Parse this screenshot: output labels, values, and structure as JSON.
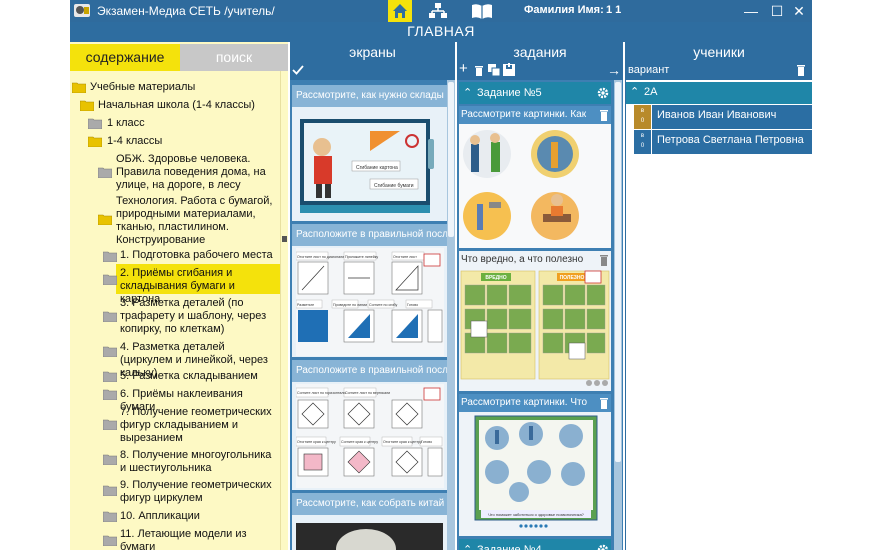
{
  "app": {
    "title": "Экзамен-Медиа СЕТЬ /учитель/",
    "user_label": "Фамилия Имя:",
    "user_name": "1 1",
    "main_header": "ГЛАВНАЯ"
  },
  "panel_tabs": {
    "content": "содержание",
    "search": "поиск"
  },
  "tree": [
    "Учебные материалы",
    "Начальная школа (1-4 классы)",
    "1 класс",
    "1-4 классы",
    "ОБЖ. Здоровье человека. Правила поведения дома, на улице, на дороге, в лесу",
    "Технология. Работа с бумагой, природными материалами, тканью, пластилином. Конструирование",
    "1. Подготовка рабочего места",
    "2. Приёмы сгибания и складывания бумаги и картона",
    "3. Разметка деталей (по трафарету и шаблону, через копирку, по клеткам)",
    "4. Разметка деталей (циркулем и линейкой, через кальку)",
    "5. Разметка складыванием",
    "6. Приёмы наклеивания бумаги",
    "7. Получение геометрических фигур складыванием и вырезанием",
    "8. Получение многоугольника и шестиугольника",
    "9. Получение геометрических фигур циркулем",
    "10. Аппликации",
    "11. Летающие модели из бумаги"
  ],
  "columns": {
    "screens": "экраны",
    "tasks": "задания",
    "students": "ученики"
  },
  "screens": [
    {
      "title": "Рассмотрите, как нужно склады"
    },
    {
      "title": "Расположите в правильной посл"
    },
    {
      "title": "Расположите в правильной посл"
    },
    {
      "title": "Рассмотрите, как собрать китай"
    }
  ],
  "screen_texts": {
    "fold_card": "Сгибание картона",
    "fold_paper": "Сгибание бумаги",
    "s2_labels": [
      "Отогните лист по диагонали",
      "Приложите линейку",
      "Отогните лист",
      "Разметьте",
      "Проведите по линии",
      "Согните по сгибу",
      "Готово"
    ],
    "s3_labels": [
      "Согните лист по горизонтали",
      "Согните лист по вертикали",
      "Отогните края к центру",
      "Согните края к центру",
      "Отогните края к центру",
      "Готово"
    ]
  },
  "tasks": {
    "task5": "Задание №5",
    "task4": "Задание №4",
    "cards": [
      {
        "title": "Рассмотрите картинки. Как"
      },
      {
        "title": "Что вредно, а что полезно"
      },
      {
        "title": "Рассмотрите картинки. Что"
      }
    ],
    "harmful_label": "ВРЕДНО",
    "useful_label": "ПОЛЕЗНО",
    "posture_caption": "Что поможет заботиться о здоровье позвоночника?"
  },
  "students": {
    "variant_label": "вариант",
    "class_name": "2А",
    "list": [
      {
        "mark_top": "в",
        "mark_bottom": "0",
        "name": "Иванов Иван Иванович"
      },
      {
        "mark_top": "в",
        "mark_bottom": "0",
        "name": "Петрова Светлана Петровна"
      }
    ]
  },
  "colors": {
    "accent": "#2e6da0",
    "tab_active": "#f4e20c",
    "tree_bg": "#fdf9c4"
  }
}
